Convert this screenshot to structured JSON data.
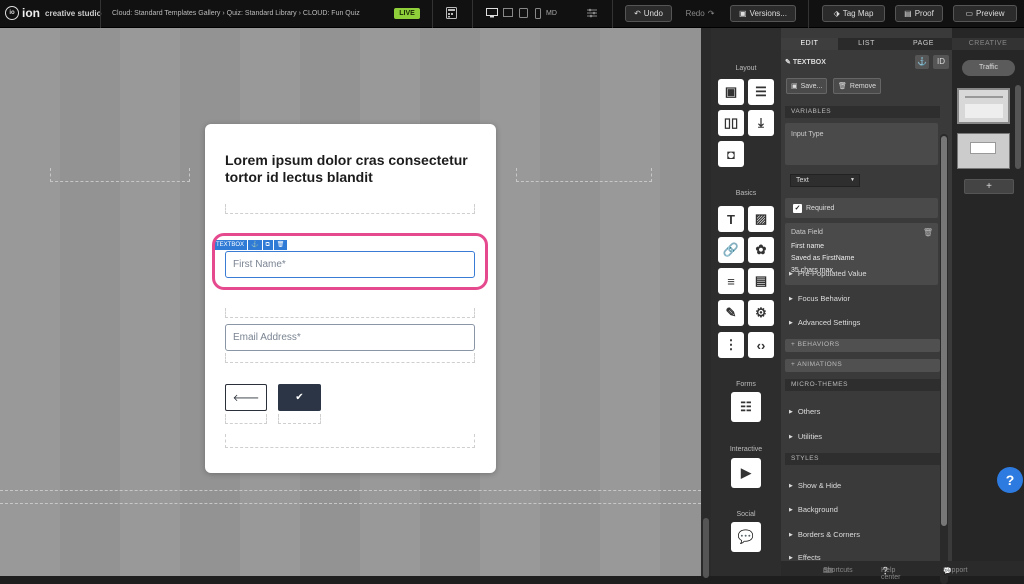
{
  "app": {
    "logo_mark": "io",
    "name": "ion",
    "subtitle": "creative studio"
  },
  "breadcrumb": "Cloud: Standard Templates Gallery › Quiz: Standard Library › CLOUD: Fun Quiz",
  "live_badge": "LIVE",
  "toolbar": {
    "device_label": "MD",
    "undo": "Undo",
    "redo": "Redo",
    "versions": "Versions...",
    "tag_map": "Tag Map",
    "proof": "Proof",
    "preview": "Preview"
  },
  "canvas": {
    "heading": "Lorem ipsum dolor cras consectetur tortor id lectus blandit",
    "textbox_tag": "TEXTBOX",
    "first_name_placeholder": "First Name*",
    "email_placeholder": "Email Address*",
    "back_icon": "🡐",
    "submit_icon": "✔"
  },
  "toolbox": {
    "layout": "Layout",
    "basics": "Basics",
    "forms": "Forms",
    "interactive": "Interactive",
    "social": "Social"
  },
  "props": {
    "tabs": [
      "EDIT",
      "LIST",
      "PAGE"
    ],
    "element_title": "TEXTBOX",
    "id_label": "ID",
    "save": "Save...",
    "remove": "Remove",
    "variables": "VARIABLES",
    "input_type_label": "Input Type",
    "input_type_value": "Text",
    "required": "Required",
    "data_field_label": "Data Field",
    "data_field_lines": [
      "First name",
      "Saved as FirstName",
      "35 chars max"
    ],
    "prepopulated": "Pre-Populated Value",
    "focus": "Focus Behavior",
    "advanced": "Advanced Settings",
    "behaviors": "+ BEHAVIORS",
    "animations": "+ ANIMATIONS",
    "micro_themes": "MICRO-THEMES",
    "others": "Others",
    "utilities": "Utilities",
    "styles": "STYLES",
    "show_hide": "Show & Hide",
    "background": "Background",
    "borders": "Borders & Corners",
    "effects": "Effects"
  },
  "creative": {
    "header": "CREATIVE",
    "traffic": "Traffic",
    "add": "+"
  },
  "footer": {
    "shortcuts": "Shortcuts",
    "help_center": "Help center",
    "support": "Support"
  },
  "help_button": "?",
  "colors": {
    "live": "#8fcf3a",
    "highlight": "#e54a8e",
    "focus": "#3a7bd5",
    "button": "#2c3545",
    "help": "#2d7be0"
  }
}
